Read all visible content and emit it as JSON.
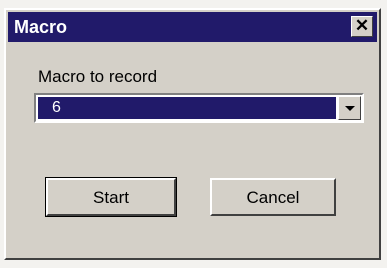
{
  "dialog": {
    "title": "Macro",
    "close_label": "✕",
    "macro_label": "Macro to record",
    "macro_value": "6",
    "start_label": "Start",
    "cancel_label": "Cancel"
  },
  "colors": {
    "titlebar": "#211a6a",
    "selection": "#211a6a",
    "face": "#d4d0c8"
  }
}
